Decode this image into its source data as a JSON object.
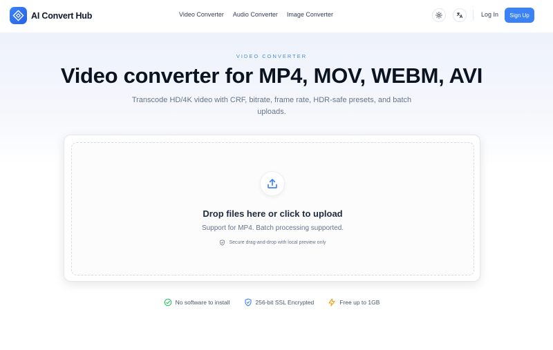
{
  "nav": {
    "brand": "AI Convert Hub",
    "links": [
      "Video Converter",
      "Audio Converter",
      "Image Converter"
    ],
    "login": "Log In",
    "signup": "Sign Up",
    "icons": [
      "sun-icon",
      "translate-icon"
    ]
  },
  "hero": {
    "eyebrow": "VIDEO CONVERTER",
    "title": "Video converter for MP4, MOV, WEBM, AVI",
    "subtitle": "Transcode HD/4K video with CRF, bitrate, frame rate, HDR-safe presets, and batch uploads."
  },
  "upload": {
    "title": "Drop files here or click to upload",
    "subtitle": "Support for MP4. Batch processing supported.",
    "secure_note": "Secure drag-and-drop with local preview only"
  },
  "features": [
    {
      "label": "No software to install",
      "icon": "check-circle-icon",
      "color": "#22c55e"
    },
    {
      "label": "256-bit SSL Encrypted",
      "icon": "shield-check-icon",
      "color": "#3b82f6"
    },
    {
      "label": "Free up to 1GB",
      "icon": "lightning-icon",
      "color": "#f59e0b"
    }
  ],
  "colors": {
    "accent": "#3b82f6",
    "eyebrow": "#4a8bd6"
  }
}
